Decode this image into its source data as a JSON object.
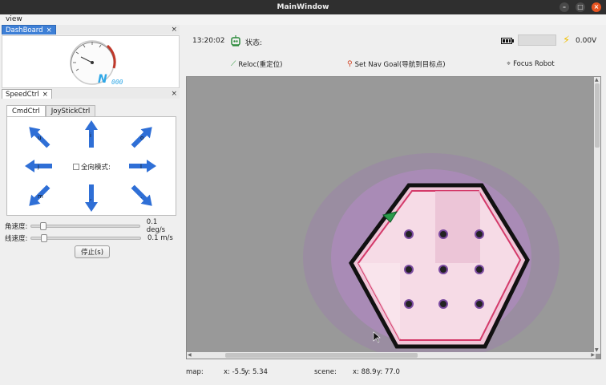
{
  "window": {
    "title": "MainWindow"
  },
  "menu": {
    "items": [
      "view"
    ]
  },
  "dashboard": {
    "tab_label": "DashBoard",
    "gauge_letter": "N",
    "gauge_digits": "000",
    "accent": "#2fa7e6"
  },
  "speed_ctrl": {
    "tab_label": "SpeedCtrl",
    "subtabs": [
      "CmdCtrl",
      "JoyStickCtrl"
    ],
    "key_labels": [
      "u",
      "i",
      "o",
      "j",
      "l",
      "m",
      ",",
      "."
    ],
    "omni_checkbox_label": "全向模式:",
    "angular": {
      "label": "角速度:",
      "value": "0.1 deg/s",
      "fraction": 0.02
    },
    "linear": {
      "label": "线速度:",
      "value": "0.1 m/s",
      "fraction": 0.02
    },
    "stop_label": "停止(s)",
    "arrow_color": "#2f6fd6"
  },
  "status": {
    "time": "13:20:02",
    "state_label": "状态:",
    "voltage": "0.00V",
    "battery_level": 0
  },
  "toolbar": {
    "reloc": "Reloc(重定位)",
    "nav_goal": "Set Nav Goal(导航到目标点)",
    "focus": "Focus Robot"
  },
  "map_status": {
    "map_label": "map:",
    "map_x": "x: -5.5",
    "map_y": "y: 5.34",
    "scene_label": "scene:",
    "scene_x": "x: 88.9",
    "scene_y": "y: 77.0"
  }
}
